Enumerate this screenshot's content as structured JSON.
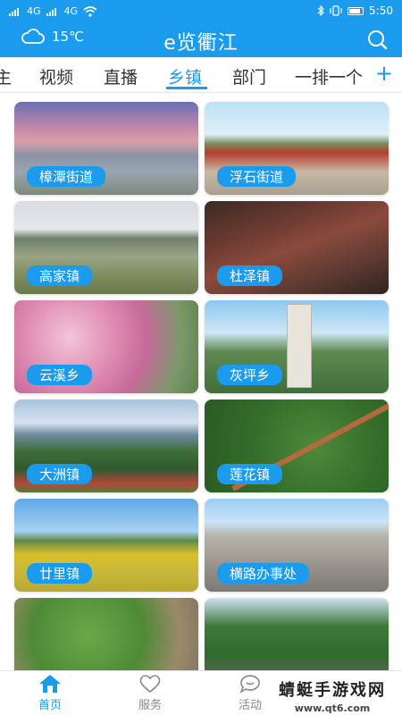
{
  "status": {
    "time": "5:50",
    "network1": "4G",
    "network2": "4G"
  },
  "header": {
    "title": "e览衢江",
    "temperature": "15℃"
  },
  "tabs": [
    {
      "label": "主"
    },
    {
      "label": "视频"
    },
    {
      "label": "直播"
    },
    {
      "label": "乡镇",
      "active": true
    },
    {
      "label": "部门"
    },
    {
      "label": "一排一个"
    }
  ],
  "tab_add": "+",
  "cards": [
    {
      "label": "樟潭街道"
    },
    {
      "label": "浮石街道"
    },
    {
      "label": "高家镇"
    },
    {
      "label": "杜泽镇"
    },
    {
      "label": "云溪乡"
    },
    {
      "label": "灰坪乡"
    },
    {
      "label": "大洲镇"
    },
    {
      "label": "莲花镇"
    },
    {
      "label": "廿里镇"
    },
    {
      "label": "横路办事处"
    },
    {
      "label": ""
    },
    {
      "label": ""
    }
  ],
  "bottom_nav": [
    {
      "label": "首页",
      "active": true
    },
    {
      "label": "服务"
    },
    {
      "label": "活动"
    }
  ],
  "watermark": {
    "line1": "蜻蜓手游戏网",
    "line2": "www.qt6.com"
  },
  "colors": {
    "accent": "#1a9bee",
    "text": "#333333"
  }
}
